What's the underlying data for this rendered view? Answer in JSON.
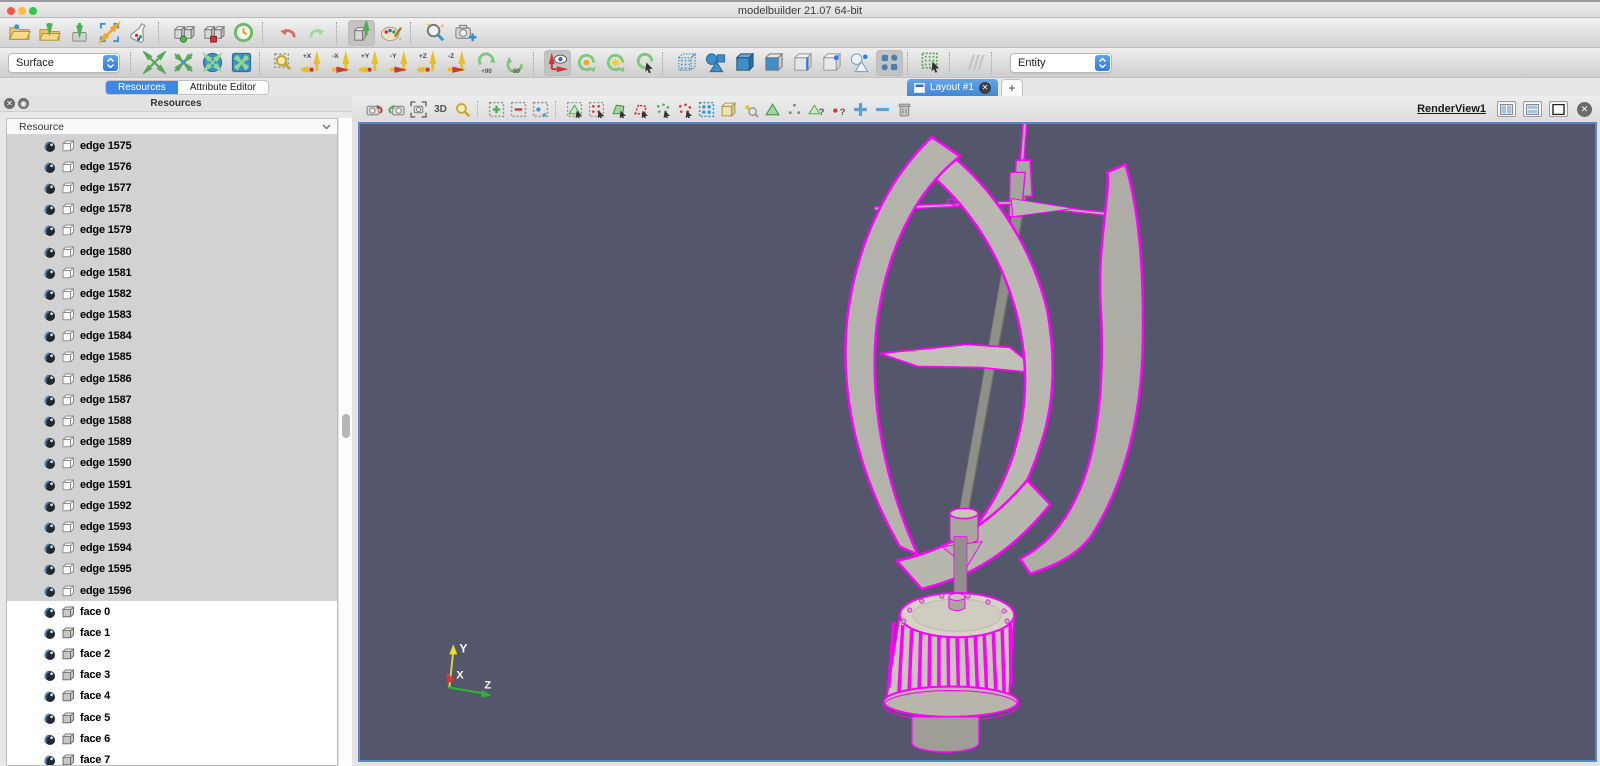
{
  "window": {
    "title": "modelbuilder 21.07 64-bit"
  },
  "toolbar_main": {
    "items": [
      {
        "name": "open-file",
        "icon": "folder-open"
      },
      {
        "name": "import-file",
        "icon": "folder-import"
      },
      {
        "name": "save-data",
        "icon": "save-data"
      },
      {
        "name": "zoom-to-data",
        "icon": "zoom-extents"
      },
      {
        "name": "color-map-editor",
        "icon": "flask"
      },
      {
        "sep": true
      },
      {
        "name": "connect-server",
        "icon": "server-connect"
      },
      {
        "name": "disconnect-server",
        "icon": "server-disconnect"
      },
      {
        "name": "reset-session",
        "icon": "history-clock"
      },
      {
        "sep": true
      },
      {
        "name": "undo",
        "icon": "undo-arrow"
      },
      {
        "name": "redo",
        "icon": "redo-arrow"
      },
      {
        "sep": true
      },
      {
        "name": "load-server-state",
        "icon": "server-up",
        "pressed": true
      },
      {
        "name": "color-palette",
        "icon": "palette"
      },
      {
        "sep": true
      },
      {
        "name": "zoom-search",
        "icon": "magnifier-blue"
      },
      {
        "name": "capture-screenshot",
        "icon": "camera-plus"
      }
    ]
  },
  "toolbar_secondary": {
    "representation_value": "Surface",
    "selection_value": "Entity",
    "items": [
      {
        "name": "reset-camera",
        "icon": "arrows-out"
      },
      {
        "name": "zoom-closest",
        "icon": "arrows-in"
      },
      {
        "name": "rubber-band-zoom",
        "icon": "sphere-arrows"
      },
      {
        "name": "rubber-band-box",
        "icon": "box-arrows"
      },
      {
        "sep": true
      },
      {
        "name": "zoom-to-box",
        "icon": "zoom-box"
      },
      {
        "name": "set-view-plus-x",
        "icon": "axis-move",
        "label": "+X"
      },
      {
        "name": "set-view-minus-x",
        "icon": "axis-move",
        "label": "-X"
      },
      {
        "name": "set-view-plus-y",
        "icon": "axis-move",
        "label": "+Y"
      },
      {
        "name": "set-view-minus-y",
        "icon": "axis-move",
        "label": "-Y"
      },
      {
        "name": "set-view-plus-z",
        "icon": "axis-move",
        "label": "+Z"
      },
      {
        "name": "set-view-minus-z",
        "icon": "axis-move",
        "label": "-Z"
      },
      {
        "name": "rotate-90-cw",
        "icon": "rotate-cw",
        "label": "+90"
      },
      {
        "name": "rotate-90-ccw",
        "icon": "rotate-ccw",
        "label": "-90"
      },
      {
        "sep": true
      },
      {
        "name": "center-axes-visibility",
        "icon": "axis-eye",
        "pressed": true
      },
      {
        "name": "show-orientation-axes",
        "icon": "rotate-orange"
      },
      {
        "name": "set-rotation-center",
        "icon": "rotate-sun"
      },
      {
        "name": "pick-rotation-center",
        "icon": "rotate-cursor"
      },
      {
        "sep": true
      },
      {
        "name": "representation-points",
        "icon": "cube-points"
      },
      {
        "name": "representation-outline",
        "icon": "shapes-blue"
      },
      {
        "name": "representation-surface",
        "icon": "cube-solid"
      },
      {
        "name": "representation-surface-edges",
        "icon": "cube-face"
      },
      {
        "name": "representation-wireframe",
        "icon": "cube-edge"
      },
      {
        "name": "representation-volume",
        "icon": "cube-vertex"
      },
      {
        "name": "representation-glyphs",
        "icon": "shapes-outline"
      },
      {
        "name": "multi-block-inspector",
        "icon": "dots-grid",
        "pressed": true
      },
      {
        "sep": true
      },
      {
        "name": "select-surface-entities",
        "icon": "grid-cursor"
      },
      {
        "sep": true
      },
      {
        "name": "interactive-select",
        "icon": "slashes"
      },
      {
        "sep": true
      }
    ]
  },
  "panel_tabs": {
    "items": [
      {
        "label": "Resources",
        "active": true
      },
      {
        "label": "Attribute Editor",
        "active": false
      }
    ]
  },
  "layout_tabs": {
    "active_label": "Layout #1",
    "new_tab_label": "+"
  },
  "resources_panel": {
    "title": "Resources",
    "tree_header": "Resource",
    "items": [
      {
        "label": "edge 1575",
        "type": "edge",
        "highlighted": true
      },
      {
        "label": "edge 1576",
        "type": "edge",
        "highlighted": true
      },
      {
        "label": "edge 1577",
        "type": "edge",
        "highlighted": true
      },
      {
        "label": "edge 1578",
        "type": "edge",
        "highlighted": true
      },
      {
        "label": "edge 1579",
        "type": "edge",
        "highlighted": true
      },
      {
        "label": "edge 1580",
        "type": "edge",
        "highlighted": true
      },
      {
        "label": "edge 1581",
        "type": "edge",
        "highlighted": true
      },
      {
        "label": "edge 1582",
        "type": "edge",
        "highlighted": true
      },
      {
        "label": "edge 1583",
        "type": "edge",
        "highlighted": true
      },
      {
        "label": "edge 1584",
        "type": "edge",
        "highlighted": true
      },
      {
        "label": "edge 1585",
        "type": "edge",
        "highlighted": true
      },
      {
        "label": "edge 1586",
        "type": "edge",
        "highlighted": true
      },
      {
        "label": "edge 1587",
        "type": "edge",
        "highlighted": true
      },
      {
        "label": "edge 1588",
        "type": "edge",
        "highlighted": true
      },
      {
        "label": "edge 1589",
        "type": "edge",
        "highlighted": true
      },
      {
        "label": "edge 1590",
        "type": "edge",
        "highlighted": true
      },
      {
        "label": "edge 1591",
        "type": "edge",
        "highlighted": true
      },
      {
        "label": "edge 1592",
        "type": "edge",
        "highlighted": true
      },
      {
        "label": "edge 1593",
        "type": "edge",
        "highlighted": true
      },
      {
        "label": "edge 1594",
        "type": "edge",
        "highlighted": true
      },
      {
        "label": "edge 1595",
        "type": "edge",
        "highlighted": true
      },
      {
        "label": "edge 1596",
        "type": "edge",
        "highlighted": true
      },
      {
        "label": "face 0",
        "type": "face",
        "highlighted": false
      },
      {
        "label": "face 1",
        "type": "face",
        "highlighted": false
      },
      {
        "label": "face 2",
        "type": "face",
        "highlighted": false
      },
      {
        "label": "face 3",
        "type": "face",
        "highlighted": false
      },
      {
        "label": "face 4",
        "type": "face",
        "highlighted": false
      },
      {
        "label": "face 5",
        "type": "face",
        "highlighted": false
      },
      {
        "label": "face 6",
        "type": "face",
        "highlighted": false
      },
      {
        "label": "face 7",
        "type": "face",
        "highlighted": false
      }
    ]
  },
  "view_toolbar": {
    "items": [
      {
        "name": "export-scene",
        "icon": "camera-red"
      },
      {
        "name": "import-scene",
        "icon": "camera-green"
      },
      {
        "name": "capture-view",
        "icon": "camera-crop"
      },
      {
        "name": "toggle-3d",
        "icon": "text-3d",
        "label": "3D"
      },
      {
        "name": "zoom-to-selection",
        "icon": "magnifier-small"
      },
      {
        "sep": true
      },
      {
        "name": "add-to-selection",
        "icon": "box-plus"
      },
      {
        "name": "subtract-from-selection",
        "icon": "box-minus"
      },
      {
        "name": "toggle-selection",
        "icon": "box-toggle"
      },
      {
        "sep": true
      },
      {
        "name": "select-cells-on",
        "icon": "dashed-triangle"
      },
      {
        "name": "select-points-on",
        "icon": "dashed-points"
      },
      {
        "name": "select-cells-through",
        "icon": "poly-green"
      },
      {
        "name": "select-points-through",
        "icon": "poly-red"
      },
      {
        "name": "select-cells-polygon",
        "icon": "sparkle-green"
      },
      {
        "name": "select-points-polygon",
        "icon": "sparkle-red"
      },
      {
        "name": "select-block",
        "icon": "dots-blue"
      },
      {
        "name": "select-frustum",
        "icon": "cube-tan"
      },
      {
        "name": "hover-cells",
        "icon": "dot-magnifier"
      },
      {
        "name": "hover-points",
        "icon": "triangle-green"
      },
      {
        "name": "select-mesh-points",
        "icon": "dots-gray"
      },
      {
        "name": "query-cells",
        "icon": "triangle-question"
      },
      {
        "name": "query-points",
        "icon": "dot-question"
      },
      {
        "name": "grow-selection",
        "icon": "plus-blue"
      },
      {
        "name": "shrink-selection",
        "icon": "minus-blue"
      },
      {
        "name": "clear-selection",
        "icon": "trash"
      }
    ]
  },
  "render_view": {
    "title": "RenderView1",
    "axis_labels": {
      "x": "X",
      "y": "Y",
      "z": "Z"
    }
  },
  "colors": {
    "accent_blue": "#3f87e5",
    "viewport_background": "#54566B",
    "selection_highlight": "#FF00FF",
    "model_surface": "#b2b1a9",
    "axis_x": "#e03434",
    "axis_y": "#e8d820",
    "axis_z": "#2fb42f",
    "traffic_red": "#f5574e",
    "traffic_yellow": "#f6bd3e",
    "traffic_green": "#33c748"
  }
}
